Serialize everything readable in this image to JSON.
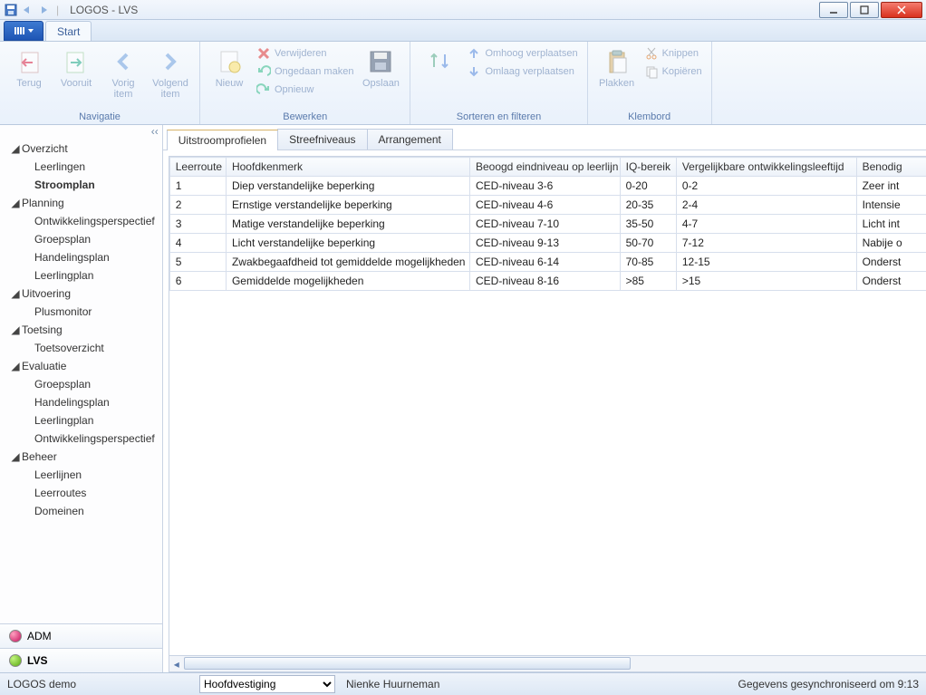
{
  "title": "LOGOS - LVS",
  "ribbon": {
    "tab_start": "Start",
    "groups": {
      "nav": {
        "label": "Navigatie",
        "back": "Terug",
        "forward": "Vooruit",
        "prev_item": "Vorig\nitem",
        "next_item": "Volgend\nitem"
      },
      "edit": {
        "label": "Bewerken",
        "new": "Nieuw",
        "delete": "Verwijderen",
        "undo": "Ongedaan maken",
        "redo": "Opnieuw",
        "save": "Opslaan"
      },
      "sort": {
        "label": "Sorteren en filteren",
        "move_up": "Omhoog verplaatsen",
        "move_down": "Omlaag verplaatsen"
      },
      "clip": {
        "label": "Klembord",
        "paste": "Plakken",
        "cut": "Knippen",
        "copy": "Kopiëren"
      }
    }
  },
  "tree": {
    "s0": "Overzicht",
    "s0_i0": "Leerlingen",
    "s0_i1": "Stroomplan",
    "s1": "Planning",
    "s1_i0": "Ontwikkelingsperspectief",
    "s1_i1": "Groepsplan",
    "s1_i2": "Handelingsplan",
    "s1_i3": "Leerlingplan",
    "s2": "Uitvoering",
    "s2_i0": "Plusmonitor",
    "s3": "Toetsing",
    "s3_i0": "Toetsoverzicht",
    "s4": "Evaluatie",
    "s4_i0": "Groepsplan",
    "s4_i1": "Handelingsplan",
    "s4_i2": "Leerlingplan",
    "s4_i3": "Ontwikkelingsperspectief",
    "s5": "Beheer",
    "s5_i0": "Leerlijnen",
    "s5_i1": "Leerroutes",
    "s5_i2": "Domeinen"
  },
  "bottom_tabs": {
    "adm": "ADM",
    "lvs": "LVS"
  },
  "doc_tabs": {
    "t0": "Uitstroomprofielen",
    "t1": "Streefniveaus",
    "t2": "Arrangement"
  },
  "columns": {
    "c0": "Leerroute",
    "c1": "Hoofdkenmerk",
    "c2": "Beoogd eindniveau op leerlijn",
    "c3": "IQ-bereik",
    "c4": "Vergelijkbare ontwikkelingsleeftijd",
    "c5": "Benodig"
  },
  "rows": [
    {
      "c0": "1",
      "c1": "Diep verstandelijke beperking",
      "c2": "CED-niveau 3-6",
      "c3": "0-20",
      "c4": "0-2",
      "c5": "Zeer int"
    },
    {
      "c0": "2",
      "c1": "Ernstige verstandelijke beperking",
      "c2": "CED-niveau 4-6",
      "c3": "20-35",
      "c4": "2-4",
      "c5": "Intensie"
    },
    {
      "c0": "3",
      "c1": "Matige verstandelijke beperking",
      "c2": "CED-niveau 7-10",
      "c3": "35-50",
      "c4": "4-7",
      "c5": "Licht int"
    },
    {
      "c0": "4",
      "c1": "Licht verstandelijke beperking",
      "c2": "CED-niveau 9-13",
      "c3": "50-70",
      "c4": "7-12",
      "c5": "Nabije o"
    },
    {
      "c0": "5",
      "c1": "Zwakbegaafdheid tot gemiddelde mogelijkheden",
      "c2": "CED-niveau 6-14",
      "c3": "70-85",
      "c4": "12-15",
      "c5": "Onderst"
    },
    {
      "c0": "6",
      "c1": "Gemiddelde mogelijkheden",
      "c2": "CED-niveau 8-16",
      "c3": ">85",
      "c4": ">15",
      "c5": "Onderst"
    }
  ],
  "status": {
    "tenant": "LOGOS demo",
    "location": "Hoofdvestiging",
    "user": "Nienke Huurneman",
    "sync": "Gegevens gesynchroniseerd om 9:13"
  }
}
